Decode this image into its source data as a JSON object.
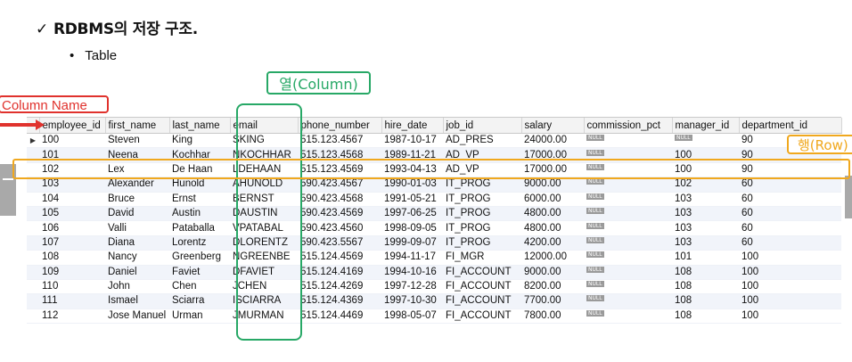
{
  "heading": {
    "check": "✓",
    "text": "RDBMS의 저장 구조."
  },
  "bullet": {
    "dot": "•",
    "text": "Table"
  },
  "annotations": {
    "column_name": "Column Name",
    "column": "열(Column)",
    "row": "행(Row)"
  },
  "colors": {
    "red": "#e0322d",
    "green": "#27a866",
    "orange": "#f0a81e"
  },
  "grid": {
    "headers": [
      "",
      "employee_id",
      "first_name",
      "last_name",
      "email",
      "phone_number",
      "hire_date",
      "job_id",
      "salary",
      "commission_pct",
      "manager_id",
      "department_id"
    ],
    "row_indicator": "▶",
    "null_label": "NULL",
    "rows": [
      [
        "100",
        "Steven",
        "King",
        "SKING",
        "515.123.4567",
        "1987-10-17",
        "AD_PRES",
        "24000.00",
        "NULL",
        "NULL",
        "90"
      ],
      [
        "101",
        "Neena",
        "Kochhar",
        "NKOCHHAR",
        "515.123.4568",
        "1989-11-21",
        "AD_VP",
        "17000.00",
        "NULL",
        "100",
        "90"
      ],
      [
        "102",
        "Lex",
        "De Haan",
        "LDEHAAN",
        "515.123.4569",
        "1993-04-13",
        "AD_VP",
        "17000.00",
        "NULL",
        "100",
        "90"
      ],
      [
        "103",
        "Alexander",
        "Hunold",
        "AHUNOLD",
        "590.423.4567",
        "1990-01-03",
        "IT_PROG",
        "9000.00",
        "NULL",
        "102",
        "60"
      ],
      [
        "104",
        "Bruce",
        "Ernst",
        "BERNST",
        "590.423.4568",
        "1991-05-21",
        "IT_PROG",
        "6000.00",
        "NULL",
        "103",
        "60"
      ],
      [
        "105",
        "David",
        "Austin",
        "DAUSTIN",
        "590.423.4569",
        "1997-06-25",
        "IT_PROG",
        "4800.00",
        "NULL",
        "103",
        "60"
      ],
      [
        "106",
        "Valli",
        "Pataballa",
        "VPATABAL",
        "590.423.4560",
        "1998-09-05",
        "IT_PROG",
        "4800.00",
        "NULL",
        "103",
        "60"
      ],
      [
        "107",
        "Diana",
        "Lorentz",
        "DLORENTZ",
        "590.423.5567",
        "1999-09-07",
        "IT_PROG",
        "4200.00",
        "NULL",
        "103",
        "60"
      ],
      [
        "108",
        "Nancy",
        "Greenberg",
        "NGREENBE",
        "515.124.4569",
        "1994-11-17",
        "FI_MGR",
        "12000.00",
        "NULL",
        "101",
        "100"
      ],
      [
        "109",
        "Daniel",
        "Faviet",
        "DFAVIET",
        "515.124.4169",
        "1994-10-16",
        "FI_ACCOUNT",
        "9000.00",
        "NULL",
        "108",
        "100"
      ],
      [
        "110",
        "John",
        "Chen",
        "JCHEN",
        "515.124.4269",
        "1997-12-28",
        "FI_ACCOUNT",
        "8200.00",
        "NULL",
        "108",
        "100"
      ],
      [
        "111",
        "Ismael",
        "Sciarra",
        "ISCIARRA",
        "515.124.4369",
        "1997-10-30",
        "FI_ACCOUNT",
        "7700.00",
        "NULL",
        "108",
        "100"
      ],
      [
        "112",
        "Jose Manuel",
        "Urman",
        "JMURMAN",
        "515.124.4469",
        "1998-05-07",
        "FI_ACCOUNT",
        "7800.00",
        "NULL",
        "108",
        "100"
      ]
    ]
  }
}
